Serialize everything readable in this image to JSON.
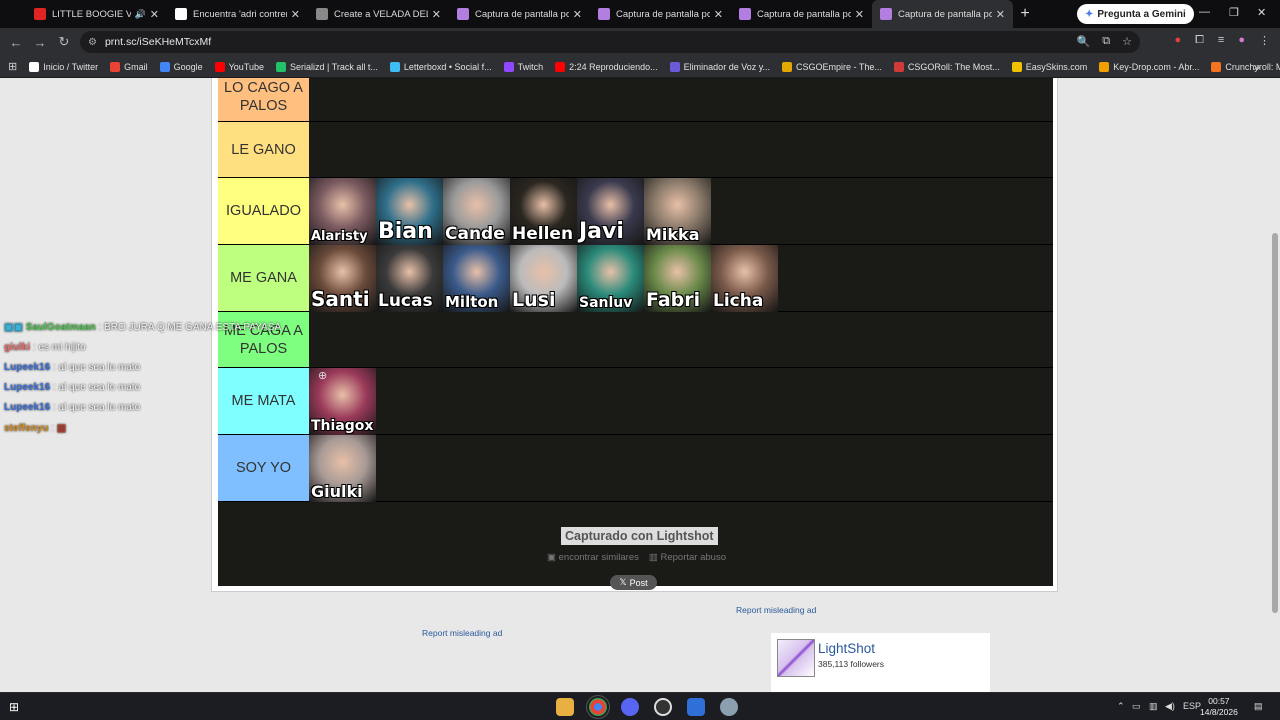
{
  "tabs": [
    {
      "label": "LITTLE BOOGIE VS EL",
      "favicon_color": "#e02424",
      "active": false,
      "sound": true
    },
    {
      "label": "Encuentra 'adri contreras' e",
      "favicon_color": "#ffffff",
      "active": false
    },
    {
      "label": "Create a VELADA DEL AÑO",
      "favicon_color": "#888888",
      "active": false
    },
    {
      "label": "Captura de pantalla por Li",
      "favicon_color": "#b27ee0",
      "active": false
    },
    {
      "label": "Captura de pantalla por Li",
      "favicon_color": "#b27ee0",
      "active": false
    },
    {
      "label": "Captura de pantalla por Li",
      "favicon_color": "#b27ee0",
      "active": false
    },
    {
      "label": "Captura de pantalla por Li",
      "favicon_color": "#b27ee0",
      "active": true
    }
  ],
  "gemini_button": "Pregunta a Gemini",
  "url": "prnt.sc/iSeKHeMTcxMf",
  "bookmarks": [
    {
      "label": "Inicio / Twitter",
      "color": "#ffffff"
    },
    {
      "label": "Gmail",
      "color": "#ea4335"
    },
    {
      "label": "Google",
      "color": "#4285f4"
    },
    {
      "label": "YouTube",
      "color": "#ff0000"
    },
    {
      "label": "Serializd | Track all t...",
      "color": "#23c06a"
    },
    {
      "label": "Letterboxd • Social f...",
      "color": "#40bcf4"
    },
    {
      "label": "Twitch",
      "color": "#9146ff"
    },
    {
      "label": "2:24 Reproduciendo...",
      "color": "#ff0000"
    },
    {
      "label": "Eliminador de Voz y...",
      "color": "#6b5bd6"
    },
    {
      "label": "CSGOEmpire - The...",
      "color": "#e0a800"
    },
    {
      "label": "CSGORoll: The Most...",
      "color": "#d23a3a"
    },
    {
      "label": "EasySkins.com",
      "color": "#f2c200"
    },
    {
      "label": "Key-Drop.com - Abr...",
      "color": "#f2a000"
    },
    {
      "label": "Crunchyroll: Mira an...",
      "color": "#f47521"
    }
  ],
  "tiers": [
    {
      "label": "LO CAGO A PALOS",
      "color": "#ffbf7f",
      "items": []
    },
    {
      "label": "LE GANO",
      "color": "#ffdf7f",
      "items": []
    },
    {
      "label": "IGUALADO",
      "color": "#ffff7f",
      "items": [
        {
          "name": "Alaristy",
          "bg": "#7a5a60"
        },
        {
          "name": "Bian",
          "bg": "#2f6f8a"
        },
        {
          "name": "Cande",
          "bg": "#9a9a9a"
        },
        {
          "name": "Hellen",
          "bg": "#2a2620"
        },
        {
          "name": "Javi",
          "bg": "#3a3a4e"
        },
        {
          "name": "Mikka",
          "bg": "#8a7a6a"
        }
      ]
    },
    {
      "label": "ME GANA",
      "color": "#bfff7f",
      "items": [
        {
          "name": "Santi",
          "bg": "#6a4a3a"
        },
        {
          "name": "Lucas",
          "bg": "#3a3a3a"
        },
        {
          "name": "Milton",
          "bg": "#3a5a8a"
        },
        {
          "name": "Lusi",
          "bg": "#bbbbbb"
        },
        {
          "name": "Sanluv",
          "bg": "#2a8a7a"
        },
        {
          "name": "Fabri",
          "bg": "#6a8a4a"
        },
        {
          "name": "Licha",
          "bg": "#7a5a4a"
        }
      ]
    },
    {
      "label": "ME CAGA A PALOS",
      "color": "#7fff7f",
      "items": []
    },
    {
      "label": "ME MATA",
      "color": "#7fffff",
      "items": [
        {
          "name": "Thiagox",
          "bg": "#9a3a5a"
        }
      ]
    },
    {
      "label": "SOY YO",
      "color": "#7fbfff",
      "items": [
        {
          "name": "Giulki",
          "bg": "#a89a96"
        }
      ]
    }
  ],
  "chat": [
    {
      "user": "SaulGoatmaan",
      "user_color": "#4fc24f",
      "text": ": BRO JURA Q ME GANA ESTA PAYASA",
      "badge": true
    },
    {
      "user": "giulki",
      "user_color": "#e86a6a",
      "text": ": es mi hijito"
    },
    {
      "user": "Lupeek16",
      "user_color": "#3a6fd8",
      "text": ": al que sea lo mato"
    },
    {
      "user": "Lupeek16",
      "user_color": "#3a6fd8",
      "text": ": al que sea lo mato"
    },
    {
      "user": "Lupeek16",
      "user_color": "#3a6fd8",
      "text": ": al que sea lo mato"
    },
    {
      "user": "steffenyu",
      "user_color": "#d08a20",
      "text": ":"
    }
  ],
  "captured_label": "Capturado con Lightshot",
  "find_similar": "encontrar similares",
  "report_abuse": "Reportar abuso",
  "post_label": "Post",
  "report_misleading": "Report misleading ad",
  "lightshot": {
    "name": "LightShot",
    "followers": "385,113 followers"
  },
  "taskbar": {
    "lang": "ESP",
    "time": "00:57",
    "date": "14/8/2026"
  }
}
